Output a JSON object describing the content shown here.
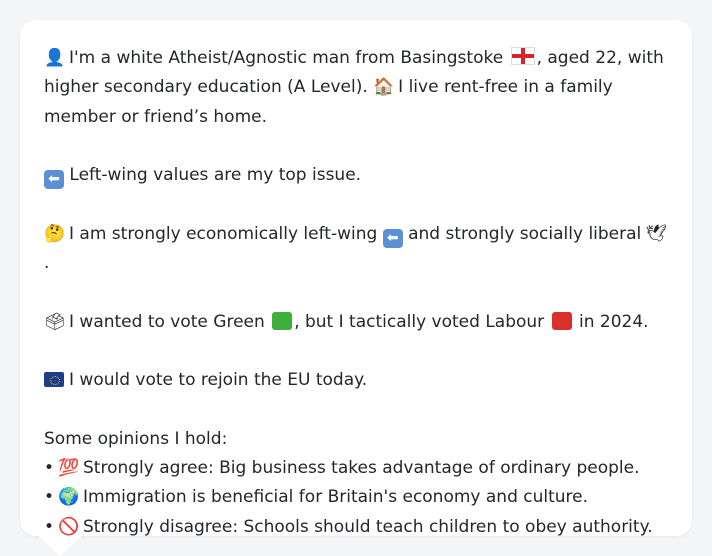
{
  "profile": {
    "intro_emoji": "👤",
    "intro_text_1": "I'm a white Atheist/Agnostic man from Basingstoke",
    "intro_flag_icon": "england-flag-icon",
    "intro_text_2": ", aged 22, with higher secondary education (A Level).",
    "home_emoji": "🏠",
    "home_text": "I live rent-free in a family member or friend’s home."
  },
  "top_issue": {
    "arrow_glyph": "⬅",
    "text": "Left-wing values are my top issue."
  },
  "ideology": {
    "emoji": "🤔",
    "text_1": "I am strongly economically left-wing",
    "arrow_glyph": "⬅",
    "text_2": "and strongly socially liberal",
    "dove_emoji": "🕊",
    "text_3": "."
  },
  "vote": {
    "emoji": "🗳",
    "text_1": "I wanted to vote Green",
    "green_swatch_color": "#3fae3a",
    "text_2": ", but I tactically voted Labour",
    "red_swatch_color": "#d9302b",
    "text_3": "in 2024."
  },
  "eu": {
    "flag_icon": "eu-flag-icon",
    "text": "I would vote to rejoin the EU today."
  },
  "opinions": {
    "heading": "Some opinions I hold:",
    "bullet": "•",
    "items": [
      {
        "emoji": "💯",
        "text": "Strongly agree: Big business takes advantage of ordinary people."
      },
      {
        "emoji": "🌍",
        "text": "Immigration is beneficial for Britain's economy and culture."
      },
      {
        "emoji": "🚫",
        "text": "Strongly disagree: Schools should teach children to obey authority."
      }
    ]
  }
}
